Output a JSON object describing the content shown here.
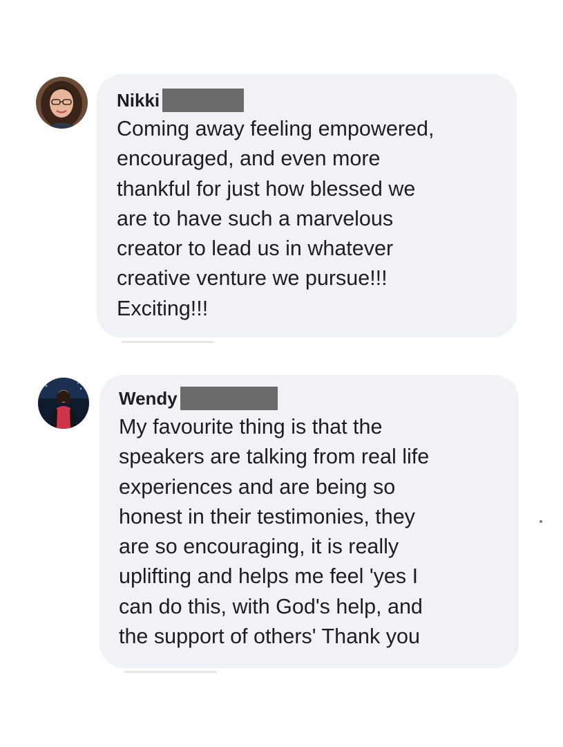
{
  "comments": [
    {
      "author": "Nikki",
      "lines": "Coming away feeling empowered,\nencouraged, and even more\nthankful for just how blessed we\nare to have such a marvelous\ncreator to lead us in whatever\ncreative venture we pursue!!!\nExciting!!!",
      "avatar_icon": "profile-photo-icon"
    },
    {
      "author": "Wendy",
      "lines": "My favourite thing is that the\nspeakers are talking from real life\nexperiences and are being so\nhonest in their testimonies, they\nare so encouraging, it is really\nuplifting and helps me feel 'yes I\ncan do this, with God's help, and\nthe support of others' Thank you",
      "avatar_icon": "profile-photo-icon"
    }
  ],
  "colors": {
    "bubble": "#f0f2f5",
    "text": "#1c1e21",
    "redaction": "#6a6a6a"
  }
}
